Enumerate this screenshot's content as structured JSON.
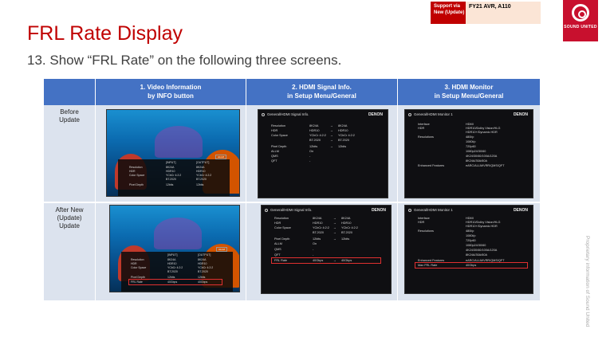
{
  "header": {
    "title": "FRL Rate Display",
    "subtitle": "13. Show “FRL Rate” on the following three screens."
  },
  "support": {
    "label": "Support via New (Update)",
    "value": "FY21 AVR, A110"
  },
  "logo": {
    "icon": "sound-united-logo",
    "text": "SOUND UNITED",
    "color": "#c8102e"
  },
  "footer_note": "Proprietary information of Sound United",
  "table": {
    "columns": [
      {
        "line1": "1. Video Information",
        "line2": "by INFO button"
      },
      {
        "line1": "2. HDMI Signal Info.",
        "line2": "in Setup Menu/General"
      },
      {
        "line1": "3. HDMI Monitor",
        "line2": "in Setup Menu/General"
      }
    ],
    "rows": [
      {
        "label_lines": [
          "Before",
          "Update"
        ]
      },
      {
        "label_lines": [
          "After New",
          "(Update)",
          "Update"
        ]
      }
    ],
    "header_color": "#4472c4"
  },
  "video_screen": {
    "allm_badge": "ALLM",
    "input_header": "[INPUT]",
    "output_header": "[OUTPUT]",
    "rows": [
      {
        "label": "Resolution",
        "input": "8K24A",
        "output": "8K24A"
      },
      {
        "label": "HDR",
        "input": "HDR10",
        "output": "HDR10"
      },
      {
        "label": "Color Space",
        "input": "YCbCr 4:2:2",
        "output": "YCbCr 4:2:2"
      },
      {
        "label": "",
        "input": "BT.2020",
        "output": "BT.2020"
      },
      {
        "label": "Pixel Depth",
        "input": "12bits",
        "output": "12bits"
      }
    ],
    "frl_row": {
      "label": "FRL Rate",
      "input": "40Gbps",
      "output": "40Gbps"
    }
  },
  "signal_screen": {
    "title": "General/HDMI Signal Info.",
    "brand": "DENON",
    "rows": [
      {
        "label": "Resolution",
        "input": "8K24A",
        "arrow": "→",
        "output": "8K24A"
      },
      {
        "label": "HDR",
        "input": "HDR10",
        "arrow": "→",
        "output": "HDR10"
      },
      {
        "label": "Color Space",
        "input": "YCbCr 4:2:2",
        "arrow": "→",
        "output": "YCbCr 4:2:2"
      },
      {
        "label": "",
        "input": "BT.2020",
        "arrow": "→",
        "output": "BT.2020"
      },
      {
        "label": "Pixel Depth",
        "input": "12bits",
        "arrow": "→",
        "output": "12bits"
      },
      {
        "label": "ALLM",
        "input": "On",
        "arrow": "",
        "output": ""
      },
      {
        "label": "QMS",
        "input": "-",
        "arrow": "",
        "output": ""
      },
      {
        "label": "QFT",
        "input": "-",
        "arrow": "",
        "output": ""
      }
    ],
    "frl_row": {
      "label": "FRL Rate",
      "input": "40Gbps",
      "arrow": "→",
      "output": "40Gbps"
    }
  },
  "monitor_screen": {
    "title": "General/HDMI Monitor 1",
    "brand": "DENON",
    "interface": {
      "label": "Interface",
      "value": "HDMI"
    },
    "hdr": {
      "label": "HDR",
      "values": [
        "HDR10/Dolby Vision/HLG",
        "HDR10+/Dynamic HDR"
      ]
    },
    "resolutions": {
      "label": "Resolutions",
      "values": [
        "480i/p",
        "1080i/p",
        "720p60",
        "1080p24/30/60",
        "4K24/30/60/100A/120A",
        "8K24A/30A/60A"
      ]
    },
    "features": {
      "label": "Enhanced Features",
      "value": "eARC/ALLM/VRR/QMS/QFT"
    },
    "frl_row": {
      "label": "Max FRL Rate",
      "value": "40Gbps"
    }
  }
}
